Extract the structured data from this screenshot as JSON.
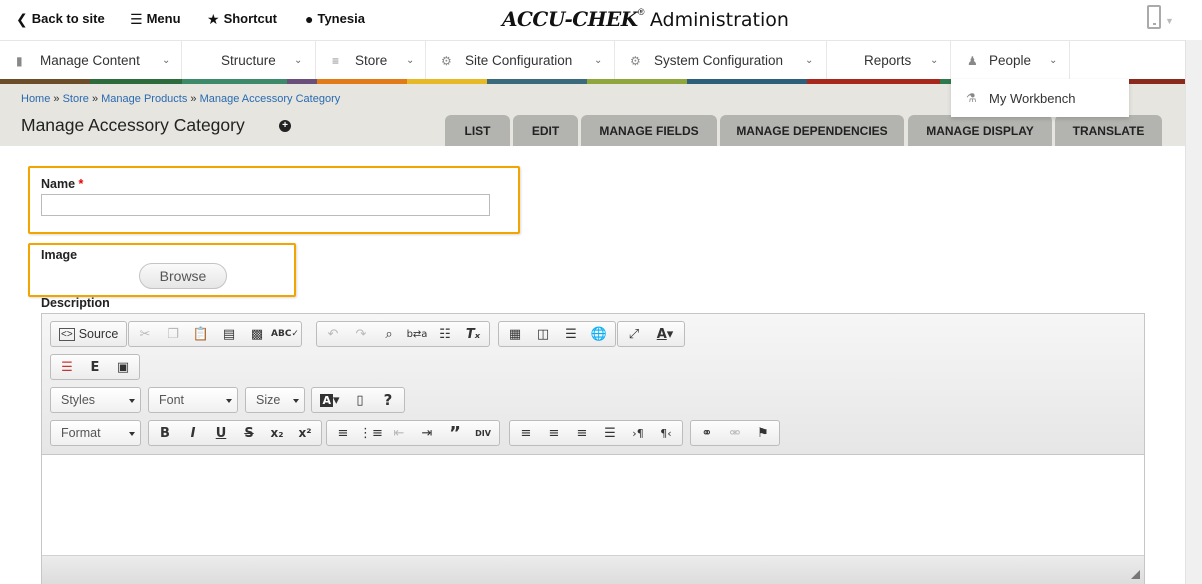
{
  "topbar": {
    "back": "Back to site",
    "menu": "Menu",
    "shortcut": "Shortcut",
    "user": "Tynesia",
    "brand_main": "ACCU-CHEK",
    "brand_reg": "®",
    "brand_sub": "Administration"
  },
  "menu": {
    "items": [
      {
        "label": "Manage Content"
      },
      {
        "label": "Structure"
      },
      {
        "label": "Store"
      },
      {
        "label": "Site Configuration"
      },
      {
        "label": "System Configuration"
      },
      {
        "label": "Reports"
      },
      {
        "label": "People"
      }
    ],
    "dropdown_item": "My Workbench",
    "strip_colors": [
      "#6b4d2a",
      "#2e6b3c",
      "#3d8a6b",
      "#6a4f7a",
      "#e07b17",
      "#e8b927",
      "#3b6a7c",
      "#8fa63c",
      "#2d5f7a",
      "#a8271d",
      "#2e7a4c",
      "#8a2a1d"
    ]
  },
  "breadcrumb": [
    "Home",
    "Store",
    "Manage Products",
    "Manage Accessory Category"
  ],
  "page_title": "Manage Accessory Category",
  "tabs": [
    "LIST",
    "EDIT",
    "MANAGE FIELDS",
    "MANAGE DEPENDENCIES",
    "MANAGE DISPLAY",
    "TRANSLATE"
  ],
  "form": {
    "name_label": "Name",
    "required_mark": "*",
    "name_value": "",
    "image_label": "Image",
    "browse_label": "Browse",
    "description_label": "Description"
  },
  "editor": {
    "source_label": "Source",
    "styles": "Styles",
    "font": "Font",
    "size": "Size",
    "format": "Format"
  },
  "colors": {
    "highlight": "#f0a500",
    "header_bg": "#e6e5df",
    "tab_bg": "#b3b3b0",
    "link": "#2a6ab1"
  }
}
